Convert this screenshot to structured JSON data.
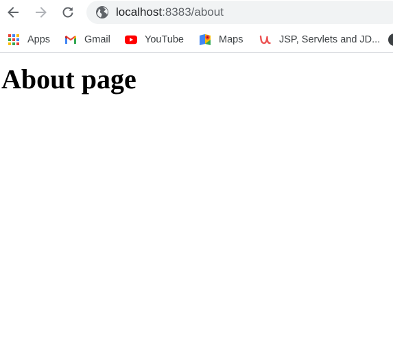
{
  "toolbar": {
    "url_host": "localhost",
    "url_rest": ":8383/about"
  },
  "bookmarks": {
    "items": [
      {
        "label": "Apps",
        "icon": "apps-grid-icon"
      },
      {
        "label": "Gmail",
        "icon": "gmail-icon"
      },
      {
        "label": "YouTube",
        "icon": "youtube-icon"
      },
      {
        "label": "Maps",
        "icon": "maps-icon"
      },
      {
        "label": "JSP, Servlets and JD...",
        "icon": "udemy-icon"
      }
    ]
  },
  "page": {
    "heading": "About page"
  },
  "colors": {
    "omnibox_bg": "#f1f3f4",
    "icon_gray": "#5f6368",
    "youtube_red": "#ff0000",
    "udemy_red": "#ec5252"
  }
}
